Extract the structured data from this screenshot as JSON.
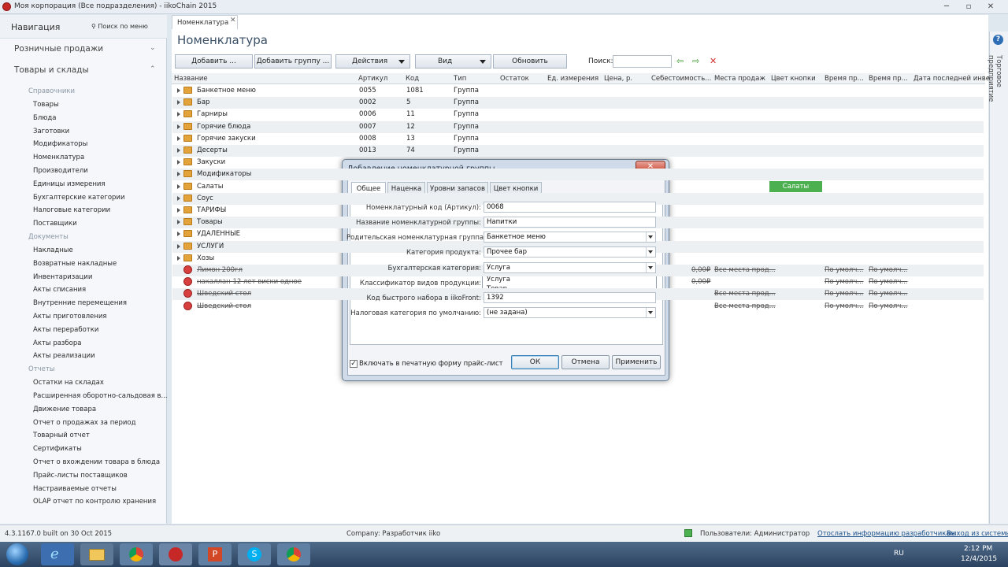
{
  "window": {
    "title": "Моя корпорация (Все подразделения)  - iikoChain 2015"
  },
  "nav": {
    "title": "Навигация",
    "search": "Поиск по меню",
    "sections": [
      "Розничные продажи",
      "Товары и склады"
    ],
    "groups": [
      "Справочники",
      "Документы",
      "Отчеты"
    ],
    "items_ref": [
      "Товары",
      "Блюда",
      "Заготовки",
      "Модификаторы",
      "Номенклатура",
      "Производители",
      "Единицы измерения",
      "Бухгалтерские категории",
      "Налоговые категории",
      "Поставщики"
    ],
    "items_docs": [
      "Накладные",
      "Возвратные накладные",
      "Инвентаризации",
      "Акты списания",
      "Внутренние перемещения",
      "Акты приготовления",
      "Акты переработки",
      "Акты разбора",
      "Акты реализации"
    ],
    "items_reports": [
      "Остатки на складах",
      "Расширенная оборотно-сальдовая в...",
      "Движение товара",
      "Отчет о продажах за период",
      "Товарный отчет",
      "Сертификаты",
      "Отчет о вхождении товара в блюда",
      "Прайс-листы поставщиков",
      "Настраиваемые отчеты",
      "OLAP отчет по контролю хранения"
    ]
  },
  "doc_tab": "Номенклатура",
  "page_title": "Номенклатура",
  "toolbar": {
    "add": "Добавить ...",
    "add_group": "Добавить группу ...",
    "actions": "Действия",
    "view": "Вид",
    "refresh": "Обновить",
    "search_label": "Поиск:"
  },
  "grid": {
    "columns": [
      "Название",
      "Артикул",
      "Код",
      "Тип",
      "Остаток",
      "Ед. измерения",
      "Цена, р.",
      "Себестоимость...",
      "Места продаж",
      "Цвет кнопки",
      "Время пр...",
      "Время пр...",
      "Дата последней инве"
    ],
    "rows": [
      {
        "name": "Банкетное меню",
        "art": "0055",
        "code": "1081",
        "type": "Группа"
      },
      {
        "name": "Бар",
        "art": "0002",
        "code": "5",
        "type": "Группа"
      },
      {
        "name": "Гарниры",
        "art": "0006",
        "code": "11",
        "type": "Группа"
      },
      {
        "name": "Горячие блюда",
        "art": "0007",
        "code": "12",
        "type": "Группа"
      },
      {
        "name": "Горячие закуски",
        "art": "0008",
        "code": "13",
        "type": "Группа"
      },
      {
        "name": "Десерты",
        "art": "0013",
        "code": "74",
        "type": "Группа"
      },
      {
        "name": "Закуски"
      },
      {
        "name": "Модификаторы"
      },
      {
        "name": "Салаты"
      },
      {
        "name": "Соус"
      },
      {
        "name": "ТАРИФЫ"
      },
      {
        "name": "Товары"
      },
      {
        "name": "УДАЛЕННЫЕ"
      },
      {
        "name": "УСЛУГИ"
      },
      {
        "name": "Хозы"
      },
      {
        "name": "Лимон 200гл"
      },
      {
        "name": "накаллан 12 лет виски одное"
      },
      {
        "name": "Шведский стол"
      },
      {
        "name": "Шведский стол"
      }
    ],
    "green_cell": "Салаты",
    "deleted_cells": {
      "cost": "0,00₽",
      "places": "Все места прод...",
      "default1": "По умолч...",
      "default2": "По умолч..."
    }
  },
  "right_panel": {
    "label": "Торговое предприятие",
    "help": "?"
  },
  "dialog": {
    "title": "Добавление номенклатурной группы",
    "tabs": [
      "Общее",
      "Наценка",
      "Уровни запасов",
      "Цвет кнопки"
    ],
    "fields": [
      {
        "label": "Номенклатурный код (Артикул):",
        "value": "0068"
      },
      {
        "label": "Название номенклатурной группы:",
        "value": "Напитки"
      },
      {
        "label": "Родительская номенклатурная группа:",
        "value": "Банкетное меню"
      },
      {
        "label": "Категория продукта:",
        "value": "Прочее бар"
      },
      {
        "label": "Бухгалтерская категория:",
        "value": "Услуга"
      },
      {
        "label": "Классификатор видов продукции:",
        "value": ""
      },
      {
        "label": "Код быстрого набора в iikoFront:",
        "value": "1392"
      },
      {
        "label": "Налоговая категория по умолчанию:",
        "value": "(не задана)"
      }
    ],
    "dropdown_options": [
      "Услуга",
      "Товар"
    ],
    "checkbox_label": "Включать в печатную форму прайс-лист",
    "ok": "ОК",
    "cancel": "Отмена",
    "apply": "Применить"
  },
  "status": {
    "version": "4.3.1167.0 built on 30 Oct 2015",
    "company": "Company: Разработчик iiko",
    "users": "Пользователи: Администратор",
    "send": "Отослать информацию разработчикам",
    "exit": "Выход из системы"
  },
  "tray": {
    "lang": "RU",
    "time": "2:12 PM",
    "date": "12/4/2015"
  }
}
